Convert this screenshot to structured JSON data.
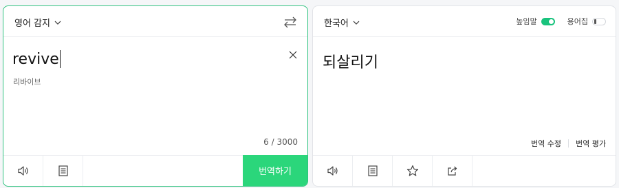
{
  "source": {
    "language": "영어 감지",
    "text": "revive",
    "pronunciation": "리바이브",
    "char_count": "6 / 3000",
    "translate_label": "번역하기"
  },
  "target": {
    "language": "한국어",
    "text": "되살리기",
    "honorific_label": "높임말",
    "honorific_on": true,
    "glossary_label": "용어집",
    "glossary_on": false,
    "edit_label": "번역 수정",
    "rate_label": "번역 평가"
  },
  "colors": {
    "accent": "#2bd67b",
    "border_active": "#2ec27e"
  },
  "icons": {
    "swap": "swap-arrows-icon",
    "clear": "close-icon",
    "speaker": "speaker-icon",
    "dictionary": "book-icon",
    "favorite": "star-icon",
    "share": "share-icon"
  }
}
